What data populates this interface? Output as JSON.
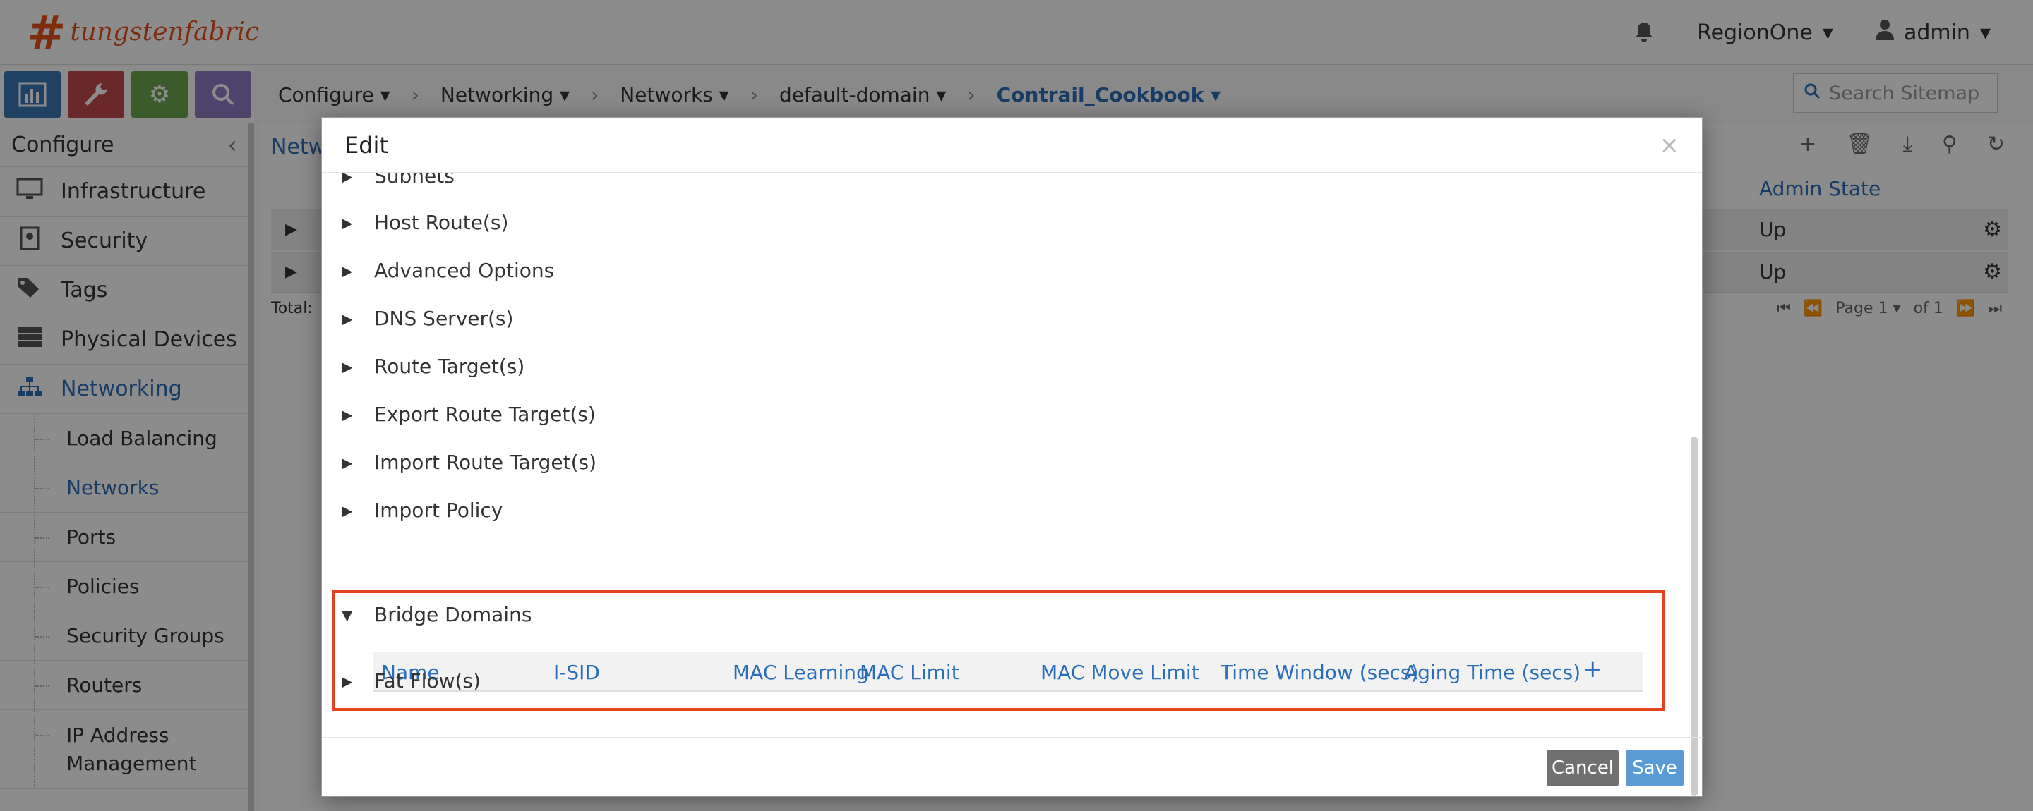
{
  "app": {
    "logo_mark": "#",
    "logo_text": "tungstenfabric"
  },
  "topbar": {
    "region": "RegionOne",
    "user": "admin"
  },
  "breadcrumb": [
    "Configure",
    "Networking",
    "Networks",
    "default-domain",
    "Contrail_Cookbook"
  ],
  "search": {
    "placeholder": "Search Sitemap"
  },
  "sidebar": {
    "title": "Configure",
    "items": [
      {
        "label": "Infrastructure",
        "icon": "monitor-icon"
      },
      {
        "label": "Security",
        "icon": "security-doc-icon"
      },
      {
        "label": "Tags",
        "icon": "tags-icon"
      },
      {
        "label": "Physical Devices",
        "icon": "server-icon"
      },
      {
        "label": "Networking",
        "icon": "network-tree-icon"
      }
    ],
    "subitems": [
      "Load Balancing",
      "Networks",
      "Ports",
      "Policies",
      "Security Groups",
      "Routers",
      "IP Address Management"
    ]
  },
  "content": {
    "title": "Netw",
    "column": "Admin State",
    "rows": [
      {
        "state": "Up"
      },
      {
        "state": "Up"
      }
    ],
    "footer": {
      "total": "Total:",
      "page": "Page 1",
      "of": "of 1"
    }
  },
  "modal": {
    "title": "Edit",
    "sections_top": [
      "Subnets",
      "Host Route(s)",
      "Advanced Options",
      "DNS Server(s)",
      "Route Target(s)",
      "Export Route Target(s)",
      "Import Route Target(s)",
      "Import Policy"
    ],
    "bridge": {
      "title": "Bridge Domains",
      "columns": [
        "Name",
        "I-SID",
        "MAC Learning",
        "MAC Limit",
        "MAC Move Limit",
        "Time Window (secs)",
        "Aging Time (secs)"
      ],
      "add": "+"
    },
    "section_bottom": "Fat Flow(s)",
    "cancel": "Cancel",
    "save": "Save"
  },
  "colors": {
    "accent": "#2a6ebb",
    "highlight": "#e4431f",
    "brand": "#e4521b"
  }
}
